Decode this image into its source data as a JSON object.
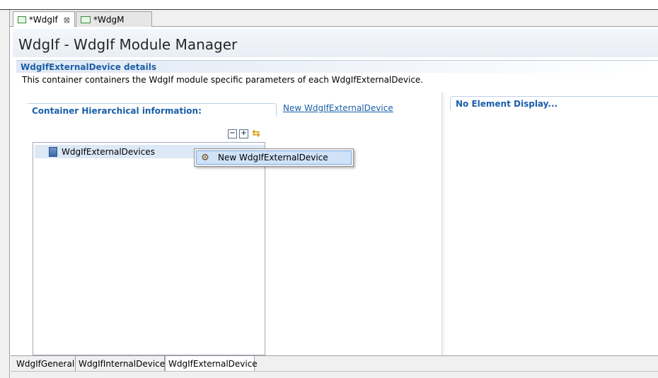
{
  "editor_tabs": [
    {
      "label": "*WdgIf",
      "close": "⊠"
    },
    {
      "label": "*WdgM"
    }
  ],
  "form": {
    "title": "WdgIf - WdgIf Module Manager"
  },
  "section": {
    "title": "WdgIfExternalDevice details",
    "description": "This container containers the WdgIf module specific parameters of each WdgIfExternalDevice."
  },
  "left_panel": {
    "title": "Container Hierarchical information:",
    "new_link": "New WdgIfExternalDevice",
    "toolbar": {
      "collapse": "−",
      "expand": "+",
      "sync": "⇆"
    },
    "tree": {
      "root_label": "WdgIfExternalDevices"
    }
  },
  "right_panel": {
    "title": "No Element Display..."
  },
  "context_menu": {
    "items": [
      {
        "label": "New WdgIfExternalDevice",
        "icon": "gear-icon"
      }
    ]
  },
  "bottom_tabs": [
    {
      "label": "WdgIfGeneral"
    },
    {
      "label": "WdgIfInternalDevice"
    },
    {
      "label": "WdgIfExternalDevice"
    }
  ],
  "colors": {
    "section_title": "#1a5fa8",
    "selection": "#dde8f6",
    "menu_highlight": "#cfe2f7"
  }
}
